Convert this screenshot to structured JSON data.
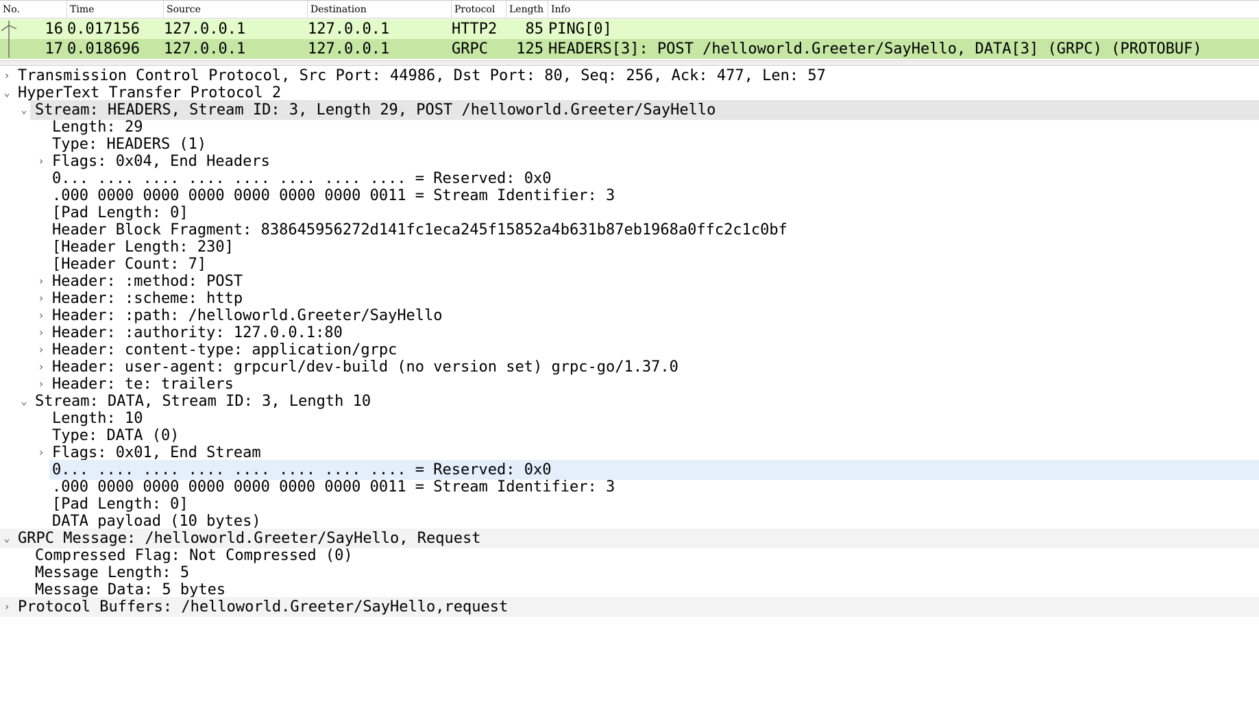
{
  "columns": [
    "No.",
    "Time",
    "Source",
    "Destination",
    "Protocol",
    "Length",
    "Info"
  ],
  "packets": [
    {
      "no": "16",
      "time": "0.017156",
      "source": "127.0.0.1",
      "destination": "127.0.0.1",
      "protocol": "HTTP2",
      "length": "85",
      "info": "PING[0]"
    },
    {
      "no": "17",
      "time": "0.018696",
      "source": "127.0.0.1",
      "destination": "127.0.0.1",
      "protocol": "GRPC",
      "length": "125",
      "info": "HEADERS[3]: POST /helloworld.Greeter/SayHello, DATA[3] (GRPC) (PROTOBUF)"
    }
  ],
  "colors": {
    "row_ping": "#e3fbc8",
    "row_grpc": "#c6e6a4",
    "selected": "#e6e6e6",
    "hover": "#e4effb"
  },
  "tree": [
    {
      "text": "Transmission Control Protocol, Src Port: 44986, Dst Port: 80, Seq: 256, Ack: 477, Len: 57",
      "arrow": "collapsed"
    },
    {
      "text": "HyperText Transfer Protocol 2",
      "arrow": "expanded"
    },
    {
      "text": "Stream: HEADERS, Stream ID: 3, Length 29, POST /helloworld.Greeter/SayHello",
      "arrow": "expanded"
    },
    {
      "text": "Length: 29",
      "arrow": "none"
    },
    {
      "text": "Type: HEADERS (1)",
      "arrow": "none"
    },
    {
      "text": "Flags: 0x04, End Headers",
      "arrow": "collapsed"
    },
    {
      "text": "0... .... .... .... .... .... .... .... = Reserved: 0x0",
      "arrow": "none"
    },
    {
      "text": ".000 0000 0000 0000 0000 0000 0000 0011 = Stream Identifier: 3",
      "arrow": "none"
    },
    {
      "text": "[Pad Length: 0]",
      "arrow": "none"
    },
    {
      "text": "Header Block Fragment: 838645956272d141fc1eca245f15852a4b631b87eb1968a0ffc2c1c0bf",
      "arrow": "none"
    },
    {
      "text": "[Header Length: 230]",
      "arrow": "none"
    },
    {
      "text": "[Header Count: 7]",
      "arrow": "none"
    },
    {
      "text": "Header: :method: POST",
      "arrow": "collapsed"
    },
    {
      "text": "Header: :scheme: http",
      "arrow": "collapsed"
    },
    {
      "text": "Header: :path: /helloworld.Greeter/SayHello",
      "arrow": "collapsed"
    },
    {
      "text": "Header: :authority: 127.0.0.1:80",
      "arrow": "collapsed"
    },
    {
      "text": "Header: content-type: application/grpc",
      "arrow": "collapsed"
    },
    {
      "text": "Header: user-agent: grpcurl/dev-build (no version set) grpc-go/1.37.0",
      "arrow": "collapsed"
    },
    {
      "text": "Header: te: trailers",
      "arrow": "collapsed"
    },
    {
      "text": "Stream: DATA, Stream ID: 3, Length 10",
      "arrow": "expanded"
    },
    {
      "text": "Length: 10",
      "arrow": "none"
    },
    {
      "text": "Type: DATA (0)",
      "arrow": "none"
    },
    {
      "text": "Flags: 0x01, End Stream",
      "arrow": "collapsed"
    },
    {
      "text": "0... .... .... .... .... .... .... .... = Reserved: 0x0",
      "arrow": "none"
    },
    {
      "text": ".000 0000 0000 0000 0000 0000 0000 0011 = Stream Identifier: 3",
      "arrow": "none"
    },
    {
      "text": "[Pad Length: 0]",
      "arrow": "none"
    },
    {
      "text": "DATA payload (10 bytes)",
      "arrow": "none"
    },
    {
      "text": "GRPC Message: /helloworld.Greeter/SayHello, Request",
      "arrow": "expanded"
    },
    {
      "text": "Compressed Flag: Not Compressed (0)",
      "arrow": "none"
    },
    {
      "text": "Message Length: 5",
      "arrow": "none"
    },
    {
      "text": "Message Data: 5 bytes",
      "arrow": "none"
    },
    {
      "text": "Protocol Buffers: /helloworld.Greeter/SayHello,request",
      "arrow": "collapsed"
    }
  ]
}
